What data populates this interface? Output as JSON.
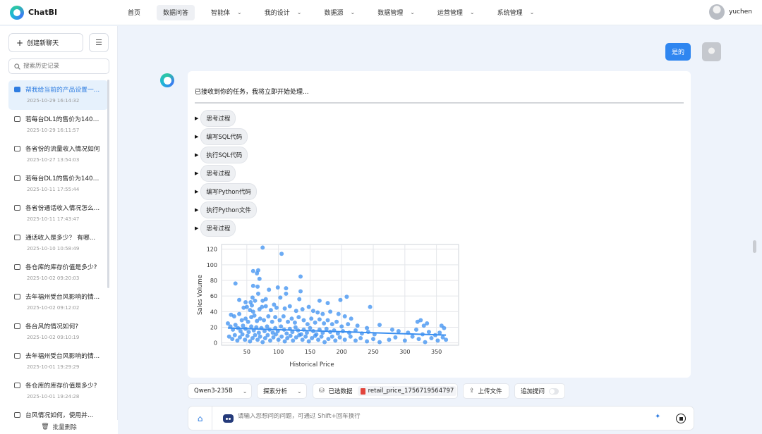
{
  "app": {
    "name": "ChatBI"
  },
  "nav": {
    "items": [
      {
        "label": "首页",
        "dropdown": false,
        "active": false
      },
      {
        "label": "数据问答",
        "dropdown": false,
        "active": true
      },
      {
        "label": "智能体",
        "dropdown": true,
        "active": false
      },
      {
        "label": "我的设计",
        "dropdown": true,
        "active": false
      },
      {
        "label": "数据源",
        "dropdown": true,
        "active": false
      },
      {
        "label": "数据管理",
        "dropdown": true,
        "active": false
      },
      {
        "label": "运营管理",
        "dropdown": true,
        "active": false
      },
      {
        "label": "系统管理",
        "dropdown": true,
        "active": false
      }
    ]
  },
  "user": {
    "name": "yuchen"
  },
  "sidebar": {
    "new_chat_label": "创建新聊天",
    "search_placeholder": "搜索历史记录",
    "bulk_delete_label": "批量删除",
    "history": [
      {
        "title": "帮我给当前的产品设置一...",
        "time": "2025-10-29 16:14:32",
        "active": true
      },
      {
        "title": "若每台DL1的售价为1400...",
        "time": "2025-10-29 16:11:57",
        "active": false
      },
      {
        "title": "各省份的流量收入情况如何",
        "time": "2025-10-27 13:54:03",
        "active": false
      },
      {
        "title": "若每台DL1的售价为1400...",
        "time": "2025-10-11 17:55:44",
        "active": false
      },
      {
        "title": "各省份通话收入情况怎么...",
        "time": "2025-10-11 17:43:47",
        "active": false
      },
      {
        "title": "通话收入是多少？ 有哪...",
        "time": "2025-10-10 10:58:49",
        "active": false
      },
      {
        "title": "各仓库的库存价值是多少?",
        "time": "2025-10-02 09:20:03",
        "active": false
      },
      {
        "title": "去年福州受台风影响的情...",
        "time": "2025-10-02 09:12:02",
        "active": false
      },
      {
        "title": "各台风的情况如何?",
        "time": "2025-10-02 09:10:19",
        "active": false
      },
      {
        "title": "去年福州受台风影响的情...",
        "time": "2025-10-01 19:29:29",
        "active": false
      },
      {
        "title": "各仓库的库存价值是多少?",
        "time": "2025-10-01 19:24:28",
        "active": false
      },
      {
        "title": "台风情况如何，使用并...",
        "time": "",
        "active": false
      }
    ]
  },
  "conversation": {
    "user_message": "是的",
    "assistant_intro": "已接收到你的任务，我将立即开始处理...",
    "steps": [
      "思考过程",
      "编写SQL代码",
      "执行SQL代码",
      "思考过程",
      "编写Python代码",
      "执行Python文件",
      "思考过程"
    ]
  },
  "chart_data": {
    "type": "scatter",
    "xlabel": "Historical Price",
    "ylabel": "Sales Volume",
    "xticks": [
      50,
      100,
      150,
      200,
      250,
      300,
      350
    ],
    "yticks": [
      0,
      20,
      40,
      60,
      80,
      100,
      120
    ],
    "xlim": [
      10,
      385
    ],
    "ylim": [
      -3,
      126
    ],
    "grid": true,
    "point_color": "#3b8ff0",
    "trend_line": {
      "x": [
        20,
        365
      ],
      "y": [
        19,
        10
      ]
    },
    "points": [
      [
        75,
        122
      ],
      [
        105,
        114
      ],
      [
        60,
        92
      ],
      [
        68,
        93
      ],
      [
        66,
        89
      ],
      [
        135,
        85
      ],
      [
        70,
        82
      ],
      [
        32,
        76
      ],
      [
        60,
        73
      ],
      [
        67,
        72
      ],
      [
        112,
        70
      ],
      [
        99,
        71
      ],
      [
        85,
        68
      ],
      [
        68,
        63
      ],
      [
        135,
        66
      ],
      [
        112,
        63
      ],
      [
        59,
        58
      ],
      [
        103,
        58
      ],
      [
        208,
        59
      ],
      [
        198,
        55
      ],
      [
        75,
        54
      ],
      [
        80,
        56
      ],
      [
        133,
        56
      ],
      [
        165,
        54
      ],
      [
        178,
        51
      ],
      [
        245,
        46
      ],
      [
        38,
        55
      ],
      [
        48,
        52
      ],
      [
        56,
        52
      ],
      [
        63,
        54
      ],
      [
        58,
        48
      ],
      [
        50,
        46
      ],
      [
        45,
        45
      ],
      [
        55,
        42
      ],
      [
        60,
        40
      ],
      [
        70,
        43
      ],
      [
        74,
        46
      ],
      [
        80,
        47
      ],
      [
        88,
        42
      ],
      [
        93,
        49
      ],
      [
        97,
        45
      ],
      [
        110,
        44
      ],
      [
        118,
        47
      ],
      [
        128,
        41
      ],
      [
        138,
        43
      ],
      [
        148,
        46
      ],
      [
        155,
        41
      ],
      [
        162,
        39
      ],
      [
        170,
        37
      ],
      [
        182,
        40
      ],
      [
        195,
        37
      ],
      [
        205,
        34
      ],
      [
        215,
        31
      ],
      [
        25,
        36
      ],
      [
        30,
        34
      ],
      [
        38,
        37
      ],
      [
        42,
        29
      ],
      [
        48,
        31
      ],
      [
        52,
        27
      ],
      [
        57,
        33
      ],
      [
        62,
        35
      ],
      [
        66,
        28
      ],
      [
        71,
        31
      ],
      [
        77,
        29
      ],
      [
        84,
        34
      ],
      [
        90,
        27
      ],
      [
        95,
        33
      ],
      [
        102,
        29
      ],
      [
        108,
        34
      ],
      [
        115,
        27
      ],
      [
        121,
        31
      ],
      [
        126,
        26
      ],
      [
        132,
        33
      ],
      [
        140,
        29
      ],
      [
        146,
        24
      ],
      [
        152,
        31
      ],
      [
        158,
        26
      ],
      [
        165,
        30
      ],
      [
        172,
        25
      ],
      [
        178,
        29
      ],
      [
        185,
        24
      ],
      [
        192,
        27
      ],
      [
        200,
        21
      ],
      [
        210,
        24
      ],
      [
        225,
        22
      ],
      [
        240,
        19
      ],
      [
        260,
        23
      ],
      [
        280,
        17
      ],
      [
        320,
        27
      ],
      [
        325,
        29
      ],
      [
        330,
        22
      ],
      [
        335,
        25
      ],
      [
        358,
        22
      ],
      [
        362,
        19
      ],
      [
        20,
        25
      ],
      [
        24,
        21
      ],
      [
        28,
        17
      ],
      [
        32,
        23
      ],
      [
        36,
        19
      ],
      [
        40,
        15
      ],
      [
        44,
        22
      ],
      [
        48,
        18
      ],
      [
        53,
        14
      ],
      [
        57,
        21
      ],
      [
        61,
        16
      ],
      [
        65,
        20
      ],
      [
        69,
        13
      ],
      [
        73,
        19
      ],
      [
        78,
        15
      ],
      [
        82,
        21
      ],
      [
        86,
        17
      ],
      [
        91,
        13
      ],
      [
        95,
        19
      ],
      [
        99,
        15
      ],
      [
        104,
        21
      ],
      [
        109,
        17
      ],
      [
        113,
        12
      ],
      [
        118,
        18
      ],
      [
        122,
        14
      ],
      [
        127,
        20
      ],
      [
        131,
        16
      ],
      [
        136,
        11
      ],
      [
        140,
        17
      ],
      [
        145,
        13
      ],
      [
        150,
        19
      ],
      [
        155,
        15
      ],
      [
        160,
        11
      ],
      [
        165,
        17
      ],
      [
        170,
        13
      ],
      [
        176,
        18
      ],
      [
        182,
        14
      ],
      [
        188,
        16
      ],
      [
        194,
        12
      ],
      [
        202,
        15
      ],
      [
        212,
        13
      ],
      [
        222,
        16
      ],
      [
        232,
        12
      ],
      [
        242,
        14
      ],
      [
        252,
        11
      ],
      [
        290,
        15
      ],
      [
        305,
        13
      ],
      [
        318,
        17
      ],
      [
        328,
        11
      ],
      [
        338,
        14
      ],
      [
        348,
        10
      ],
      [
        355,
        13
      ],
      [
        22,
        8
      ],
      [
        27,
        5
      ],
      [
        31,
        10
      ],
      [
        35,
        3
      ],
      [
        39,
        7
      ],
      [
        43,
        11
      ],
      [
        47,
        4
      ],
      [
        51,
        9
      ],
      [
        55,
        2
      ],
      [
        59,
        6
      ],
      [
        63,
        10
      ],
      [
        67,
        4
      ],
      [
        71,
        8
      ],
      [
        75,
        1
      ],
      [
        79,
        6
      ],
      [
        83,
        10
      ],
      [
        87,
        3
      ],
      [
        92,
        7
      ],
      [
        96,
        11
      ],
      [
        100,
        4
      ],
      [
        105,
        8
      ],
      [
        110,
        2
      ],
      [
        114,
        6
      ],
      [
        119,
        9
      ],
      [
        123,
        3
      ],
      [
        128,
        7
      ],
      [
        133,
        10
      ],
      [
        138,
        4
      ],
      [
        143,
        8
      ],
      [
        148,
        2
      ],
      [
        153,
        6
      ],
      [
        158,
        9
      ],
      [
        163,
        4
      ],
      [
        168,
        8
      ],
      [
        173,
        1
      ],
      [
        179,
        5
      ],
      [
        185,
        8
      ],
      [
        190,
        3
      ],
      [
        197,
        7
      ],
      [
        205,
        4
      ],
      [
        214,
        8
      ],
      [
        222,
        3
      ],
      [
        230,
        6
      ],
      [
        240,
        2
      ],
      [
        250,
        5
      ],
      [
        260,
        1
      ],
      [
        275,
        4
      ],
      [
        285,
        7
      ],
      [
        300,
        3
      ],
      [
        312,
        8
      ],
      [
        322,
        5
      ],
      [
        332,
        1
      ],
      [
        342,
        6
      ],
      [
        352,
        3
      ],
      [
        360,
        7
      ],
      [
        365,
        4
      ]
    ]
  },
  "toolbar": {
    "model": "Qwen3-235B",
    "mode": "探索分析",
    "selected_data_label": "已选数据",
    "selected_file": "retail_price_1756719564797",
    "upload_label": "上传文件",
    "followup_label": "追加提问"
  },
  "composer": {
    "placeholder": "请输入您想问的问题，可通过 Shift+回车换行"
  },
  "icons": {
    "logo": "chatbi-logo-icon",
    "chevron": "chevron-down-icon",
    "search": "search-icon",
    "chat": "chat-bubble-icon",
    "trash": "trash-icon",
    "upload": "upload-icon",
    "database": "database-icon",
    "wand": "magic-wand-icon",
    "stop": "stop-icon"
  },
  "colors": {
    "accent": "#2f86f0",
    "active_bg": "#e6f1fc"
  }
}
